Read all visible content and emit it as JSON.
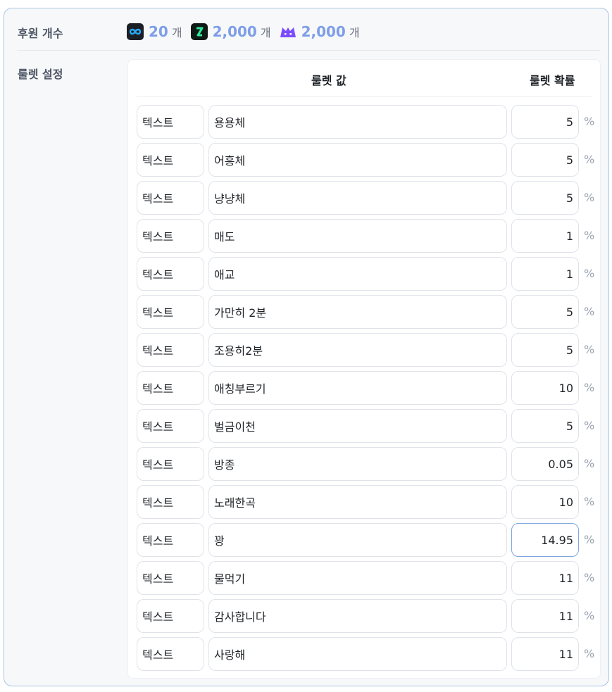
{
  "donation": {
    "label": "후원 개수",
    "items": [
      {
        "icon": "infinity-icon",
        "value": "20",
        "unit": "개",
        "color": "#7e9ee8"
      },
      {
        "icon": "z-logo-icon",
        "value": "2,000",
        "unit": "개",
        "color": "#7e9ee8"
      },
      {
        "icon": "cat-logo-icon",
        "value": "2,000",
        "unit": "개",
        "color": "#7e9ee8"
      }
    ]
  },
  "roulette": {
    "label": "룰렛 설정",
    "header_value": "룰렛 값",
    "header_prob": "룰렛 확률",
    "percent_symbol": "%",
    "rows": [
      {
        "type": "텍스트",
        "value": "용용체",
        "prob": "5"
      },
      {
        "type": "텍스트",
        "value": "어흥체",
        "prob": "5"
      },
      {
        "type": "텍스트",
        "value": "냥냥체",
        "prob": "5"
      },
      {
        "type": "텍스트",
        "value": "매도",
        "prob": "1"
      },
      {
        "type": "텍스트",
        "value": "애교",
        "prob": "1"
      },
      {
        "type": "텍스트",
        "value": "가만히 2분",
        "prob": "5"
      },
      {
        "type": "텍스트",
        "value": "조용히2분",
        "prob": "5"
      },
      {
        "type": "텍스트",
        "value": "애칭부르기",
        "prob": "10"
      },
      {
        "type": "텍스트",
        "value": "벌금이천",
        "prob": "5"
      },
      {
        "type": "텍스트",
        "value": "방종",
        "prob": "0.05"
      },
      {
        "type": "텍스트",
        "value": "노래한곡",
        "prob": "10"
      },
      {
        "type": "텍스트",
        "value": "꽝",
        "prob": "14.95"
      },
      {
        "type": "텍스트",
        "value": "물먹기",
        "prob": "11"
      },
      {
        "type": "텍스트",
        "value": "감사합니다",
        "prob": "11"
      },
      {
        "type": "텍스트",
        "value": "사랑해",
        "prob": "11"
      }
    ]
  }
}
